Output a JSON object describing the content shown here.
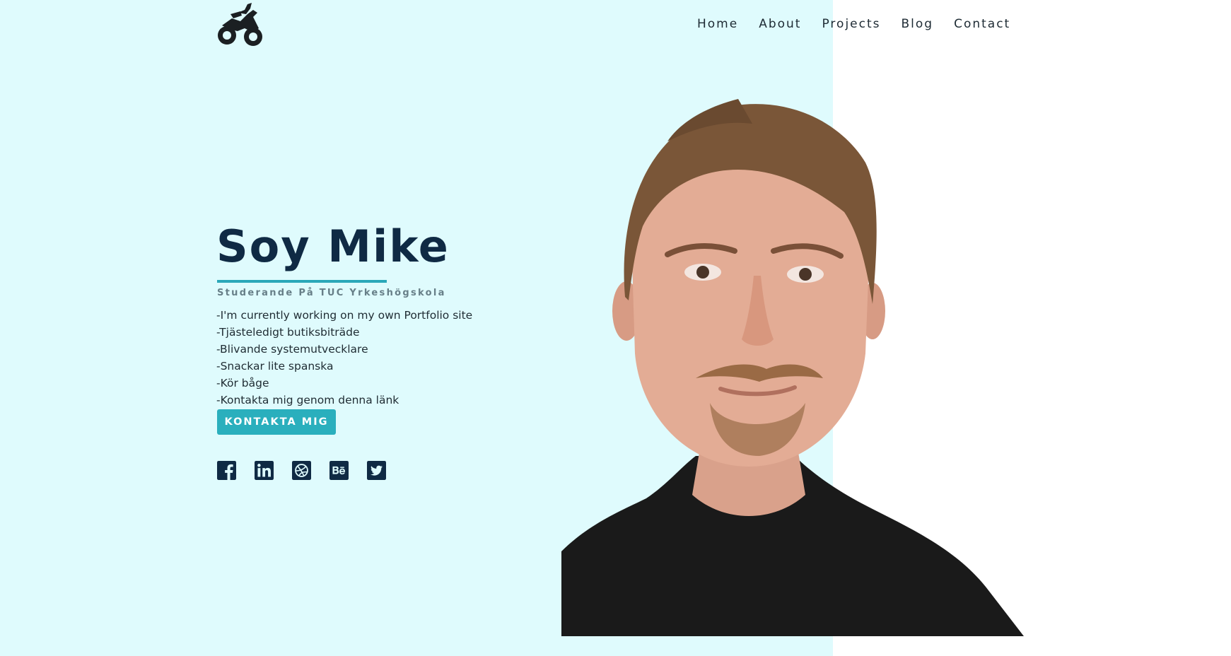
{
  "nav": {
    "items": [
      {
        "label": "Home"
      },
      {
        "label": "About"
      },
      {
        "label": "Projects"
      },
      {
        "label": "Blog"
      },
      {
        "label": "Contact"
      }
    ]
  },
  "hero": {
    "title": "Soy Mike",
    "subtitle": "Studerande På TUC Yrkeshögskola",
    "bullets": [
      "-I'm currently working on my own Portfolio site",
      "-Tjästeledigt butiksbiträde",
      "-Blivande systemutvecklare",
      "-Snackar lite spanska",
      "-Kör båge",
      "-Kontakta mig genom denna länk"
    ],
    "cta_label": "KONTAKTA MIG"
  },
  "social": {
    "icons": [
      "facebook-icon",
      "linkedin-icon",
      "dribbble-icon",
      "behance-icon",
      "twitter-icon"
    ]
  },
  "colors": {
    "left_panel_bg": "#dffbfd",
    "accent": "#2aafbd",
    "title": "#0f2a44",
    "icon": "#0f2a44"
  }
}
